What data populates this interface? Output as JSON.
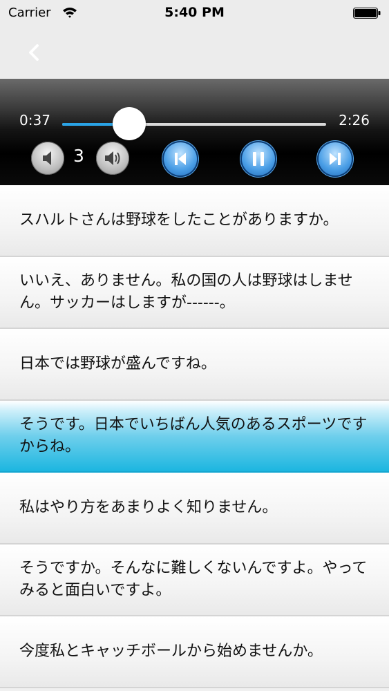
{
  "status_bar": {
    "carrier": "Carrier",
    "time": "5:40 PM"
  },
  "nav": {
    "back_icon": "chevron-left-icon"
  },
  "player": {
    "current_time": "0:37",
    "total_time": "2:26",
    "progress": 0.253,
    "volume": "3",
    "accent_color": "#2aa3e6",
    "controls": [
      "volume-down-icon",
      "volume-up-icon",
      "skip-previous-icon",
      "pause-icon",
      "skip-next-icon"
    ]
  },
  "lines": [
    {
      "text": "スハルトさんは野球をしたことがありますか。",
      "selected": false
    },
    {
      "text": "いいえ、ありません。私の国の人は野球はしません。サッカーはしますが------。",
      "selected": false
    },
    {
      "text": "日本では野球が盛んですね。",
      "selected": false
    },
    {
      "text": "そうです。日本でいちばん人気のあるスポーツですからね。",
      "selected": true
    },
    {
      "text": "私はやり方をあまりよく知りません。",
      "selected": false
    },
    {
      "text": "そうですか。そんなに難しくないんですよ。やってみると面白いですよ。",
      "selected": false
    },
    {
      "text": "今度私とキャッチボールから始めませんか。",
      "selected": false
    }
  ]
}
